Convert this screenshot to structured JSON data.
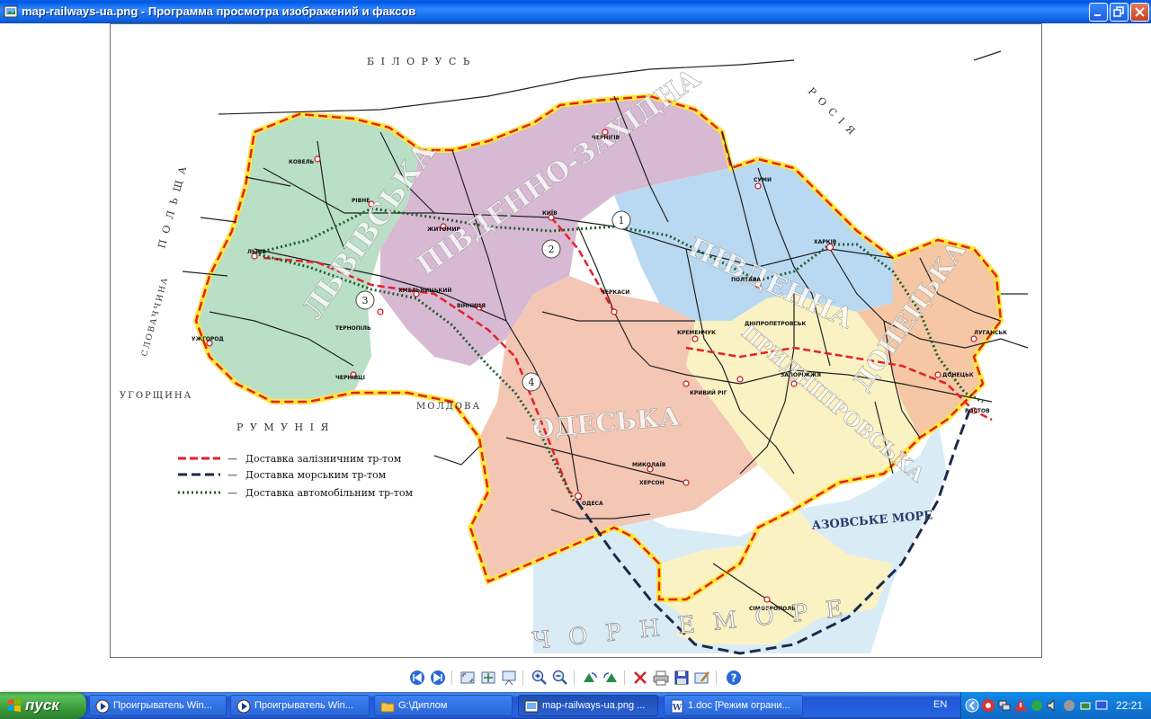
{
  "window": {
    "title": "map-railways-ua.png - Программа просмотра изображений и факсов"
  },
  "map": {
    "country_labels": {
      "belarus": "Б І Л О Р У С Ь",
      "russia": "Р О С І Я",
      "poland": "П О Л Ь Щ А",
      "slovakia": "СЛОВАЧЧИНА",
      "hungary": "УГОРЩИНА",
      "romania": "Р У М У Н І Я",
      "moldova": "МОЛДОВА"
    },
    "sea_labels": {
      "azov": "АЗОВСЬКЕ МОРЕ",
      "black": "Ч О Р Н Е   М О Р Е"
    },
    "region_labels": {
      "lviv": "ЛЬВІВСЬКА",
      "southwest": "ПІВДЕННО-ЗАХІДНА",
      "south": "ПІВДЕННА",
      "odesa": "ОДЕСЬКА",
      "prydniprovska": "ПРИДНІПРОВСЬКА",
      "donetsk": "ДОНЕЦЬКА"
    },
    "markers": [
      "1",
      "2",
      "3",
      "4"
    ],
    "cities": {
      "kyiv": "КИЇВ",
      "kharkiv": "ХАРКІВ",
      "lviv": "ЛЬВІВ",
      "odesa": "ОДЕСА",
      "dnipro": "ДНІПРОПЕТРОВСЬК",
      "zaporizhzhia": "ЗАПОРІЖЖЯ",
      "donetsk": "ДОНЕЦЬК",
      "chernihiv": "ЧЕРНІГІВ",
      "poltava": "ПОЛТАВА",
      "mykolaiv": "МИКОЛАЇВ",
      "kherson": "ХЕРСОН",
      "simferopol": "СІМФЕРОПОЛЬ",
      "vinnytsia": "ВІННИЦЯ",
      "zhytomyr": "ЖИТОМИР",
      "khmelnytskyi": "ХМЕЛЬНИЦЬКИЙ",
      "kovel": "КОВЕЛЬ",
      "rivne": "РІВНЕ",
      "ternopil": "ТЕРНОПІЛЬ",
      "chernivtsi": "ЧЕРНІВЦІ",
      "cherkasy": "ЧЕРКАСИ",
      "kremenchuk": "КРЕМЕНЧУК",
      "kryvyi_rih": "КРИВИЙ РІГ",
      "luhansk": "ЛУГАНСЬК",
      "sumy": "СУМИ",
      "uzhhorod": "УЖГОРОД",
      "rostov": "РОСТОВ"
    },
    "legend": {
      "rail": "Доставка залізничним тр-том",
      "sea": "Доставка морським тр-том",
      "road": "Доставка автомобільним тр-том",
      "dash": "—"
    },
    "colors": {
      "lviv": "#b9dfc6",
      "southwest": "#d8b9d3",
      "south": "#b9d9f2",
      "odesa": "#f4c7b5",
      "prydniprovska": "#fbf2c4",
      "donetsk": "#f5c7a5",
      "sea": "#d9ecf6",
      "border_red": "#e4202a",
      "border_yellow": "#ffe83a"
    }
  },
  "toolbar": {
    "buttons": [
      "previous-image",
      "next-image",
      "best-fit",
      "actual-size",
      "slideshow",
      "zoom-in",
      "zoom-out",
      "rotate-clockwise",
      "rotate-counterclockwise",
      "delete",
      "print",
      "copy-to",
      "edit",
      "help"
    ]
  },
  "taskbar": {
    "start": "пуск",
    "tasks": [
      "Проигрыватель Win...",
      "Проигрыватель Win...",
      "G:\\Диплом",
      "map-railways-ua.png ...",
      "1.doc [Режим ограни..."
    ],
    "lang": "EN",
    "clock": "22:21"
  }
}
